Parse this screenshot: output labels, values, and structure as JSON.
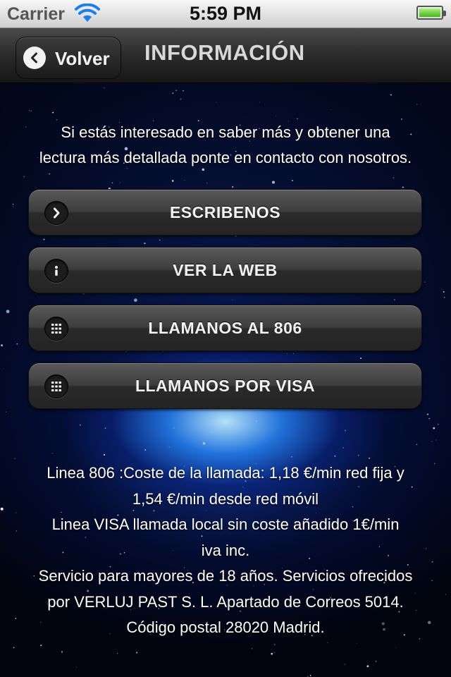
{
  "status_bar": {
    "carrier": "Carrier",
    "time": "5:59 PM",
    "wifi_icon": "wifi-icon",
    "battery_icon": "battery-full-icon",
    "battery_level": 1.0
  },
  "nav": {
    "back_label": "Volver",
    "back_icon": "chevron-left-icon",
    "title": "INFORMACIÓN"
  },
  "intro": {
    "line1": "Si estás interesado en saber más y obtener una",
    "line2": "lectura más detallada ponte en contacto con nosotros."
  },
  "buttons": [
    {
      "label": "ESCRIBENOS",
      "icon": "chevron-right-icon"
    },
    {
      "label": "VER LA WEB",
      "icon": "info-icon"
    },
    {
      "label": "LLAMANOS AL 806",
      "icon": "keypad-icon"
    },
    {
      "label": "LLAMANOS POR VISA",
      "icon": "keypad-icon"
    }
  ],
  "footer": {
    "lines": [
      "Linea 806 :Coste de la llamada: 1,18 €/min red fija y",
      "1,54 €/min desde red móvil",
      "Linea VISA llamada local sin coste añadido 1€/min",
      "iva inc.",
      "Servicio para mayores de 18 años. Servicios ofrecidos",
      "por VERLUJ PAST S. L. Apartado de Correos 5014.",
      "Código postal 28020 Madrid."
    ]
  },
  "colors": {
    "background": "#030a24",
    "glow": "#2a8cff",
    "button": "#3d3d3d",
    "text": "#ffffff"
  }
}
